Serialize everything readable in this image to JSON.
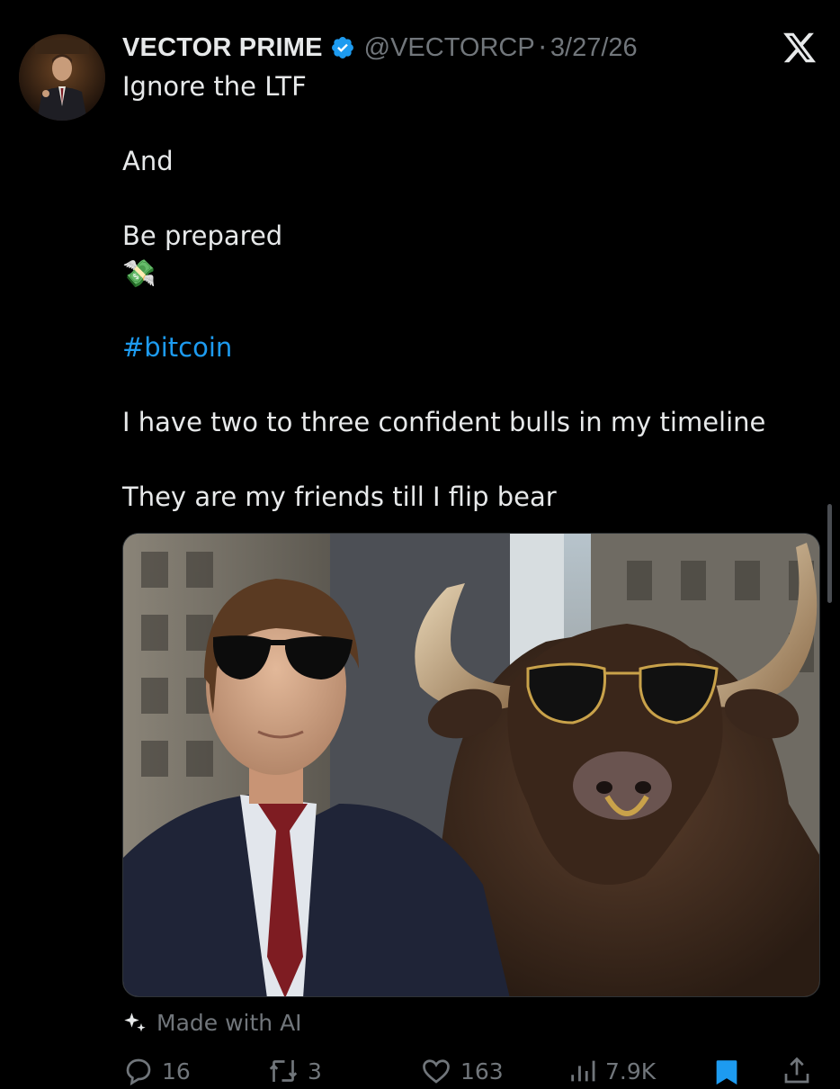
{
  "tweet": {
    "display_name": "VECTOR PRIME",
    "handle": "@VECTORCP",
    "separator": "·",
    "date": "3/27/26",
    "lines": {
      "l1": "Ignore the LTF",
      "l2": "And",
      "l3": "Be prepared",
      "l4": "💸",
      "l5": "#bitcoin",
      "l6": "I have two to three confident bulls in my timeline",
      "l7": "They are my friends till I flip bear"
    },
    "media_label": "Made with AI"
  },
  "actions": {
    "replies": "16",
    "reposts": "3",
    "likes": "163",
    "views": "7.9K"
  },
  "icons": {
    "verified": "verified-badge-icon",
    "x_logo": "x-logo-icon",
    "reply": "reply-icon",
    "repost": "repost-icon",
    "like": "heart-icon",
    "views": "views-icon",
    "bookmark": "bookmark-icon",
    "share": "share-icon",
    "sparkle": "sparkle-icon"
  },
  "colors": {
    "background": "#000000",
    "text": "#e7e9ea",
    "muted": "#71767b",
    "link": "#1d9bf0",
    "verified": "#1d9bf0"
  }
}
